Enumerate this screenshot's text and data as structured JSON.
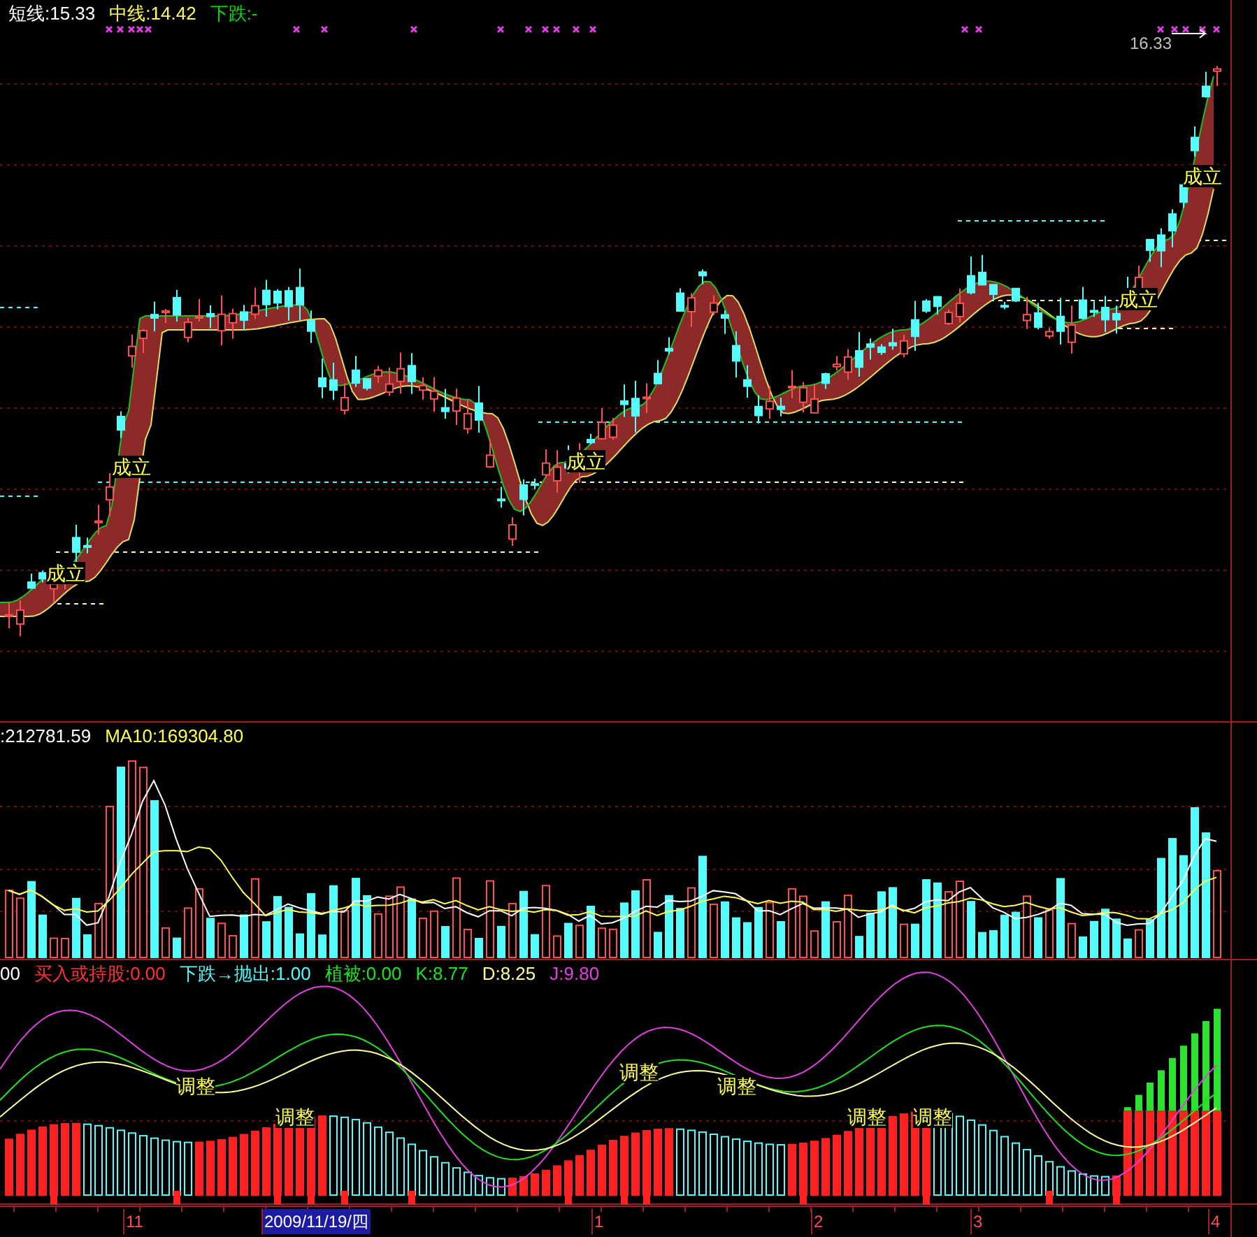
{
  "main_panel": {
    "indicators": [
      {
        "text": "短线:15.33",
        "color": "#ffffff"
      },
      {
        "text": "中线:14.42",
        "color": "#ffff54"
      },
      {
        "text": "下跌:-",
        "color": "#00e000"
      }
    ],
    "signal_labels": [
      "成立",
      "成立",
      "成立",
      "成立",
      "成立"
    ],
    "price_label": "16.33"
  },
  "volume_panel": {
    "indicators": [
      {
        "text": ":212781.59",
        "color": "#ffffff"
      },
      {
        "text": "MA10:169304.80",
        "color": "#ffff54"
      }
    ]
  },
  "kdj_panel": {
    "indicators": [
      {
        "text": "00",
        "color": "#ffffff"
      },
      {
        "text": "买入或持股:0.00",
        "color": "#ff3232"
      },
      {
        "text": "下跌→抛出:1.00",
        "color": "#54fcfc"
      },
      {
        "text": "植被:0.00",
        "color": "#20e020"
      },
      {
        "text": "K:8.77",
        "color": "#20e020"
      },
      {
        "text": "D:8.25",
        "color": "#ffffa0"
      },
      {
        "text": "J:9.80",
        "color": "#e040e0"
      }
    ],
    "signal_labels": [
      "调整",
      "调整",
      "调整",
      "调整",
      "调整",
      "调整"
    ]
  },
  "time_axis": {
    "labels": [
      {
        "text": "11",
        "selected": false
      },
      {
        "text": "2009/11/19/四",
        "selected": true
      },
      {
        "text": "1",
        "selected": false
      },
      {
        "text": "2",
        "selected": false
      },
      {
        "text": "3",
        "selected": false
      },
      {
        "text": "4",
        "selected": false
      }
    ]
  }
}
